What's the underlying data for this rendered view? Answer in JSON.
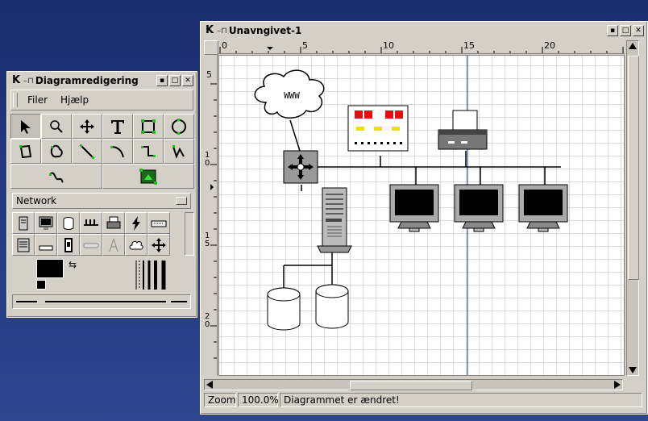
{
  "toolbox": {
    "title": "Diagramredigering",
    "menu": [
      "Filer",
      "Hjælp"
    ],
    "sheet": "Network",
    "tools": [
      "pointer",
      "zoom",
      "scroll",
      "text",
      "box",
      "ellipse",
      "polygon",
      "beziergon",
      "line",
      "arc",
      "zigzagline",
      "polyline",
      "bezierline",
      "image"
    ],
    "shape_icons": [
      "computer",
      "monitor",
      "disk",
      "hub",
      "printer",
      "lightning",
      "modem",
      "server",
      "flat-device",
      "switch",
      "storage",
      "antenna",
      "cloud",
      "router"
    ]
  },
  "diagram": {
    "title": "Unavngivet-1",
    "ruler_h": [
      "0",
      "5",
      "10",
      "15",
      "20"
    ],
    "ruler_v": [
      "5",
      "10",
      "15",
      "20"
    ],
    "cloud_label": "WWW",
    "status_zoom_label": "Zoom",
    "status_zoom_value": "100.0%",
    "status_message": "Diagrammet er ændret!"
  },
  "colors": {
    "background": "#1f3277",
    "chrome": "#d4d0c8",
    "grid": "#bfbfbf",
    "guide": "#1a3a8a",
    "red_led": "#e01010",
    "yellow_led": "#f0e000",
    "green_accent": "#20c020"
  }
}
